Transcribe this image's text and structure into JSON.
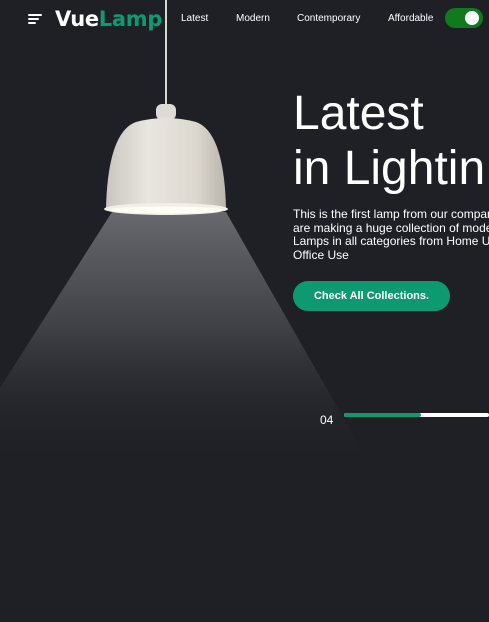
{
  "header": {
    "logo": {
      "part1": "Vue",
      "part2": "Lamp"
    },
    "menu_icon": "hamburger-menu-icon",
    "nav": [
      {
        "label": "Latest"
      },
      {
        "label": "Modern"
      },
      {
        "label": "Contemporary"
      },
      {
        "label": "Affordable"
      }
    ],
    "theme_toggle": {
      "state": "on",
      "color": "#0f7a1e"
    }
  },
  "hero": {
    "title_lines": [
      "Latest",
      "in Lightin"
    ],
    "description_lines": [
      "This is the first lamp from our company",
      "are making a huge collection of modern",
      "Lamps in all categories from Home Use",
      "Office Use"
    ],
    "cta_label": "Check All Collections."
  },
  "slider": {
    "current": "04",
    "progress": 0.53
  },
  "colors": {
    "background": "#1f2026",
    "accent": "#0e9a71",
    "text": "#ffffff"
  }
}
